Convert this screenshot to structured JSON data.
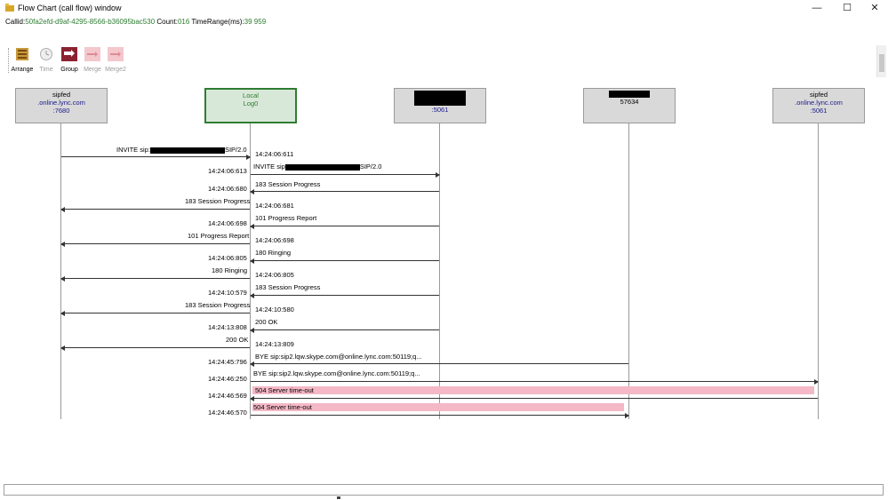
{
  "window": {
    "title": "Flow Chart (call flow) window",
    "controls": {
      "minimize": "—",
      "maximize": "☐",
      "close": "✕"
    }
  },
  "info": {
    "callid_label": "Callid:",
    "callid_value": "50fa2efd-d9af-4295-8566-b36095bac530",
    "count_label": "Count:",
    "count_value": "016",
    "timerange_label": "TimeRange(ms):",
    "timerange_value": "39 959"
  },
  "toolbar": {
    "items": [
      {
        "label": "Arrange",
        "icon": "arrange-icon",
        "enabled": true
      },
      {
        "label": "Time",
        "icon": "clock-icon",
        "enabled": false
      },
      {
        "label": "Group",
        "icon": "group-icon",
        "enabled": true
      },
      {
        "label": "Merge",
        "icon": "merge-icon",
        "enabled": false
      },
      {
        "label": "Merge2",
        "icon": "merge2-icon",
        "enabled": false
      }
    ]
  },
  "participants": [
    {
      "line1": "sipfed",
      "line2": ".online.lync.com",
      "line3": ":7680"
    },
    {
      "line1": "Local",
      "line2": "Log0",
      "line3": ""
    },
    {
      "line1": "",
      "line2": "",
      "line3": ":5061"
    },
    {
      "line1": "",
      "line2": "57634",
      "line3": ""
    },
    {
      "line1": "sipfed",
      "line2": ".online.lync.com",
      "line3": ":5061"
    }
  ],
  "messages": [
    {
      "label": "INVITE sip:",
      "suffix": "SIP/2.0",
      "time": "14:24:06:611",
      "error": false
    },
    {
      "label": "INVITE sip",
      "suffix": "SIP/2.0",
      "time": "14:24:06:613",
      "error": false
    },
    {
      "label": "183 Session Progress",
      "suffix": "",
      "time": "14:24:06:680",
      "error": false
    },
    {
      "label": "183 Session Progress",
      "suffix": "",
      "time": "14:24:06:681",
      "error": false
    },
    {
      "label": "101 Progress Report",
      "suffix": "",
      "time": "14:24:06:698",
      "error": false
    },
    {
      "label": "101 Progress Report",
      "suffix": "",
      "time": "14:24:06:698",
      "error": false
    },
    {
      "label": "180 Ringing",
      "suffix": "",
      "time": "14:24:06:805",
      "error": false
    },
    {
      "label": "180 Ringing",
      "suffix": "",
      "time": "14:24:06:805",
      "error": false
    },
    {
      "label": "183 Session Progress",
      "suffix": "",
      "time": "14:24:10:579",
      "error": false
    },
    {
      "label": "183 Session Progress",
      "suffix": "",
      "time": "14:24:10:580",
      "error": false
    },
    {
      "label": "200 OK",
      "suffix": "",
      "time": "14:24:13:808",
      "error": false
    },
    {
      "label": "200 OK",
      "suffix": "",
      "time": "14:24:13:809",
      "error": false
    },
    {
      "label": "BYE sip:sip2.lqw.skype.com@online.lync.com:50119;q...",
      "suffix": "",
      "time": "14:24:45:796",
      "error": false
    },
    {
      "label": "BYE sip:sip2.lqw.skype.com@online.lync.com:50119;q...",
      "suffix": "",
      "time": "14:24:46:250",
      "error": false
    },
    {
      "label": "504 Server time-out",
      "suffix": "",
      "time": "14:24:46:569",
      "error": true
    },
    {
      "label": "504 Server time-out",
      "suffix": "",
      "time": "14:24:46:570",
      "error": true
    }
  ],
  "colors": {
    "error_fill": "#f4b8c6",
    "local_border": "#2f7d32",
    "info_value": "#2e7d32",
    "participant_host": "#1a1a8c"
  }
}
